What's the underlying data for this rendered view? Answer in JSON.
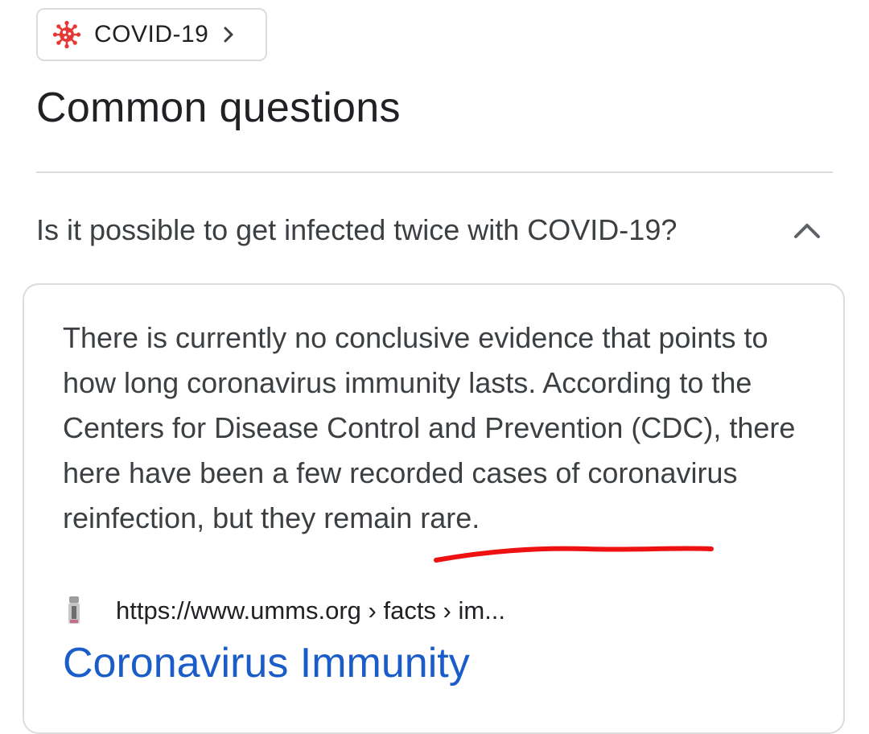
{
  "topic_chip": {
    "icon": "virus-icon",
    "label": "COVID-19",
    "chevron": "chevron-right-icon"
  },
  "section_title": "Common questions",
  "question": {
    "text": "Is it possible to get infected twice with COVID-19?",
    "expanded": true,
    "toggle_icon": "chevron-up-icon"
  },
  "answer": {
    "text": "There is currently no conclusive evidence that points to how long coronavirus immunity lasts. According to the Centers for Disease Control and Prevention (CDC), there here have been a few recorded cases of coronavirus reinfection, but they remain rare.",
    "source_icon": "site-favicon-icon",
    "source_url": "https://www.umms.org › facts › im...",
    "result_title": "Coronavirus Immunity"
  },
  "colors": {
    "accent_red": "#e53935",
    "link_blue": "#1a5cc8",
    "text": "#3c4043",
    "border": "#dadce0",
    "annotation_red": "#ee1111"
  }
}
